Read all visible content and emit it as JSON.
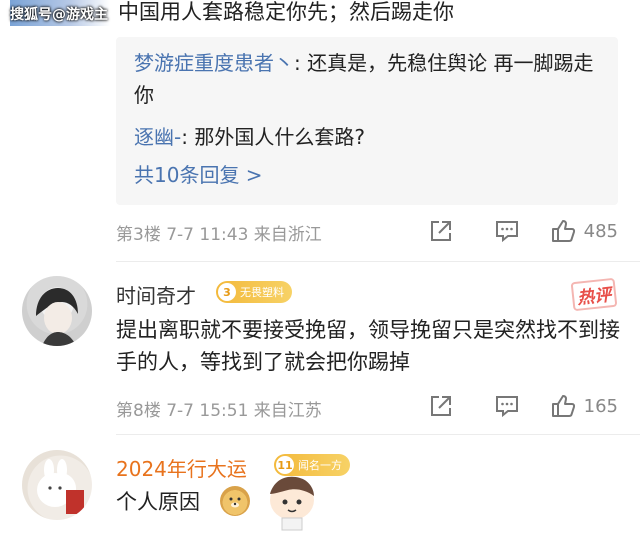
{
  "watermark": "搜狐号@游戏主",
  "top_comment_text": "中国用人套路稳定你先；然后踢走你",
  "thread1": {
    "replies": [
      {
        "nick": "梦游症重度患者丶",
        "text": ": 还真是，先稳住舆论 再一脚踢走你"
      },
      {
        "nick": "逐幽-",
        "text": ": 那外国人什么套路?"
      }
    ],
    "more_replies": "共10条回复 >",
    "meta": "第3楼  7-7 11:43  来自浙江",
    "likes": "485"
  },
  "comment2": {
    "username": "时间奇才",
    "badge_level": "3",
    "badge_text": "无畏塑料",
    "hot_label": "热评",
    "text": "提出离职就不要接受挽留，领导挽留只是突然找不到接手的人，等找到了就会把你踢掉",
    "meta": "第8楼  7-7 15:51  来自江苏",
    "likes": "165"
  },
  "comment3": {
    "username": "2024年行大运",
    "badge_level": "11",
    "badge_text": "闻名一方",
    "text": "个人原因"
  },
  "colors": {
    "nick_blue": "#4a74b0",
    "vip_orange": "#e8731d",
    "badge_gold": "#f3b93b",
    "meta_gray": "#999999"
  }
}
